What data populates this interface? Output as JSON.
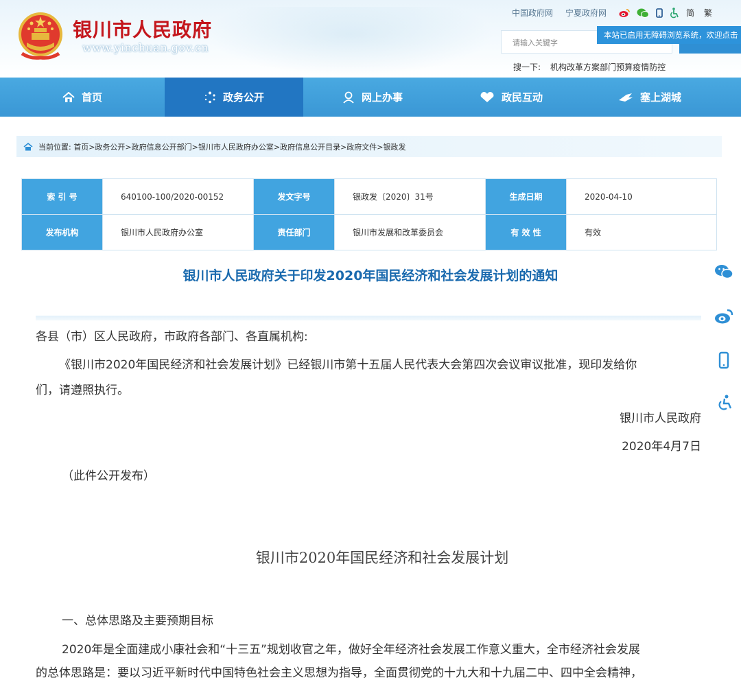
{
  "header": {
    "site_name": "银川市人民政府",
    "site_url": "www.yinchuan.gov.cn",
    "top_links": [
      "中国政府网",
      "宁夏政府网"
    ],
    "lang_simplified": "简",
    "lang_traditional": "繁",
    "search_placeholder": "请输入关键字",
    "accessibility_notice": "本站已启用无障碍浏览系统，欢迎点击",
    "hot_label": "搜一下:",
    "hot_words": [
      "机构改革方案",
      "部门预算",
      "疫情防控"
    ]
  },
  "nav": [
    {
      "label": "首页",
      "icon": "home-icon"
    },
    {
      "label": "政务公开",
      "icon": "open-dots-icon"
    },
    {
      "label": "网上办事",
      "icon": "service-person-icon"
    },
    {
      "label": "政民互动",
      "icon": "heart-hands-icon"
    },
    {
      "label": "塞上湖城",
      "icon": "bird-icon"
    }
  ],
  "breadcrumb": "当前位置:  首页>政务公开>政府信息公开部门>银川市人民政府办公室>政府信息公开目录>政府文件>银政发",
  "info": {
    "index_label": "索 引 号",
    "index_value": "640100-100/2020-00152",
    "docno_label": "发文字号",
    "docno_value": "银政发〔2020〕31号",
    "date_label": "生成日期",
    "date_value": "2020-04-10",
    "org_label": "发布机构",
    "org_value": "银川市人民政府办公室",
    "dept_label": "责任部门",
    "dept_value": "银川市发展和改革委员会",
    "valid_label": "有 效 性",
    "valid_value": "有效"
  },
  "article": {
    "title": "银川市人民政府关于印发2020年国民经济和社会发展计划的通知",
    "salutation": "各县（市）区人民政府，市政府各部门、各直属机构:",
    "body_line1": "《银川市2020年国民经济和社会发展计划》已经银川市第十五届人民代表大会第四次会议审议批准，现印发给你",
    "body_line2": "们，请遵照执行。",
    "signer": "银川市人民政府",
    "sign_date": "2020年4月7日",
    "publish_note": "（此件公开发布）",
    "plan_title": "银川市2020年国民经济和社会发展计划",
    "section1": "一、总体思路及主要预期目标",
    "para1_line1": "2020年是全面建成小康社会和“十三五”规划收官之年，做好全年经济社会发展工作意义重大，全市经济社会发展",
    "para1_line2": "的总体思路是：要以习近平新时代中国特色社会主义思想为指导，全面贯彻党的十九大和十九届二中、四中全会精神，"
  },
  "side_icons": [
    "wechat-icon",
    "weibo-icon",
    "mobile-icon",
    "accessibility-icon"
  ],
  "colors": {
    "nav_bg": "#3a97d5",
    "nav_active": "#2276c2",
    "label_bg": "#41a4e0",
    "title": "#1a6aae",
    "brand_red": "#c4161c"
  }
}
